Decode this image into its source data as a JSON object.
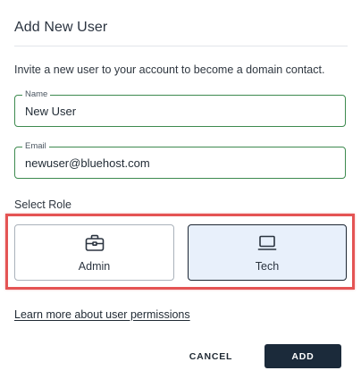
{
  "dialog": {
    "title": "Add New User",
    "description": "Invite a new user to your account to become a domain contact."
  },
  "form": {
    "name": {
      "label": "Name",
      "value": "New User"
    },
    "email": {
      "label": "Email",
      "value": "newuser@bluehost.com"
    }
  },
  "role": {
    "heading": "Select Role",
    "selected": "Tech",
    "options": [
      {
        "label": "Admin",
        "icon": "briefcase-icon"
      },
      {
        "label": "Tech",
        "icon": "laptop-icon"
      }
    ],
    "highlight_color": "#e45454"
  },
  "links": {
    "learn_more": "Learn more about user permissions"
  },
  "actions": {
    "cancel_label": "CANCEL",
    "add_label": "ADD"
  },
  "colors": {
    "field_border": "#3d8a4f",
    "primary_button": "#1b2a3a",
    "selected_card_bg": "#e8f0fb"
  }
}
